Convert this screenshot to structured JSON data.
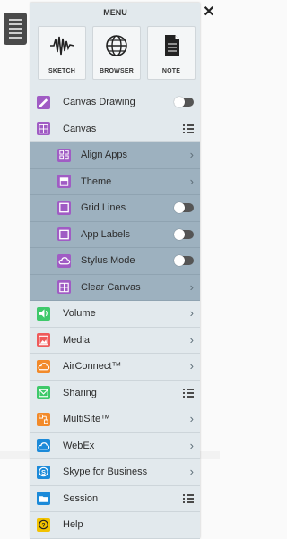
{
  "menu": {
    "title": "MENU",
    "close_label": "✕"
  },
  "launchers": [
    {
      "label": "SKETCH",
      "icon": "waveform-icon"
    },
    {
      "label": "BROWSER",
      "icon": "globe-icon"
    },
    {
      "label": "NOTE",
      "icon": "document-icon"
    }
  ],
  "items": [
    {
      "label": "Canvas Drawing",
      "icon": "pencil-icon",
      "color": "#a05cc4",
      "control": "toggle",
      "state": "off"
    },
    {
      "label": "Canvas",
      "icon": "grid-icon",
      "color": "#a05cc4",
      "control": "list"
    },
    {
      "label": "Align Apps",
      "icon": "align-icon",
      "color": "#a05cc4",
      "control": "chevron",
      "sub": true
    },
    {
      "label": "Theme",
      "icon": "theme-icon",
      "color": "#a05cc4",
      "control": "chevron",
      "sub": true
    },
    {
      "label": "Grid Lines",
      "icon": "gridlines-icon",
      "color": "#a05cc4",
      "control": "toggle",
      "state": "off",
      "sub": true
    },
    {
      "label": "App Labels",
      "icon": "label-icon",
      "color": "#a05cc4",
      "control": "toggle",
      "state": "off",
      "sub": true
    },
    {
      "label": "Stylus Mode",
      "icon": "cloud-icon",
      "color": "#a05cc4",
      "control": "toggle",
      "state": "off",
      "sub": true
    },
    {
      "label": "Clear Canvas",
      "icon": "clear-icon",
      "color": "#a05cc4",
      "control": "chevron",
      "sub": true
    },
    {
      "label": "Volume",
      "icon": "speaker-icon",
      "color": "#3ec96a",
      "control": "chevron"
    },
    {
      "label": "Media",
      "icon": "image-icon",
      "color": "#ef5a5a",
      "control": "chevron"
    },
    {
      "label": "AirConnect™",
      "icon": "cloud-icon",
      "color": "#f28a2a",
      "control": "chevron"
    },
    {
      "label": "Sharing",
      "icon": "mail-icon",
      "color": "#3ec96a",
      "control": "list"
    },
    {
      "label": "MultiSite™",
      "icon": "multisite-icon",
      "color": "#f28a2a",
      "control": "chevron"
    },
    {
      "label": "WebEx",
      "icon": "cloud-icon",
      "color": "#1b8ad9",
      "control": "chevron"
    },
    {
      "label": "Skype for Business",
      "icon": "skype-icon",
      "color": "#1b8ad9",
      "control": "chevron"
    },
    {
      "label": "Session",
      "icon": "folder-icon",
      "color": "#1b8ad9",
      "control": "list"
    },
    {
      "label": "Help",
      "icon": "help-icon",
      "color": "#f2c200",
      "control": "none"
    }
  ]
}
